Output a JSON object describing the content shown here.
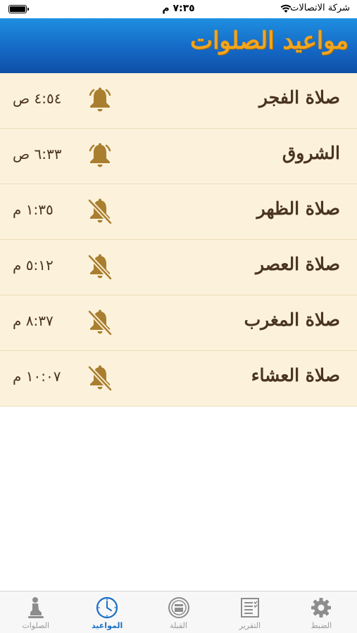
{
  "status_bar": {
    "time": "٧:٣٥ م",
    "carrier": "شركة الاتصالات"
  },
  "header": {
    "title": "مواعيد الصلوات"
  },
  "prayers": [
    {
      "name": "صلاة الفجر",
      "time": "٤:٥٤ ص",
      "alarm": "on"
    },
    {
      "name": "الشروق",
      "time": "٦:٣٣ ص",
      "alarm": "on"
    },
    {
      "name": "صلاة الظهر",
      "time": "١:٣٥ م",
      "alarm": "off"
    },
    {
      "name": "صلاة العصر",
      "time": "٥:١٢ م",
      "alarm": "off"
    },
    {
      "name": "صلاة المغرب",
      "time": "٨:٣٧ م",
      "alarm": "off"
    },
    {
      "name": "صلاة العشاء",
      "time": "١٠:٠٧ م",
      "alarm": "off"
    }
  ],
  "tabs": [
    {
      "label": "الصلوات",
      "icon": "person-praying-icon",
      "active": false
    },
    {
      "label": "المواعيد",
      "icon": "clock-icon",
      "active": true
    },
    {
      "label": "القبلة",
      "icon": "qibla-kaaba-icon",
      "active": false
    },
    {
      "label": "التقرير",
      "icon": "report-list-icon",
      "active": false
    },
    {
      "label": "الضبط",
      "icon": "gear-icon",
      "active": false
    }
  ],
  "colors": {
    "header_blue": "#1569c6",
    "title_gold": "#f3a51c",
    "row_background": "#fcf2dc",
    "bell_gold": "#a97e2f",
    "text_brown": "#4a3420",
    "tab_active": "#1a6fc9"
  }
}
